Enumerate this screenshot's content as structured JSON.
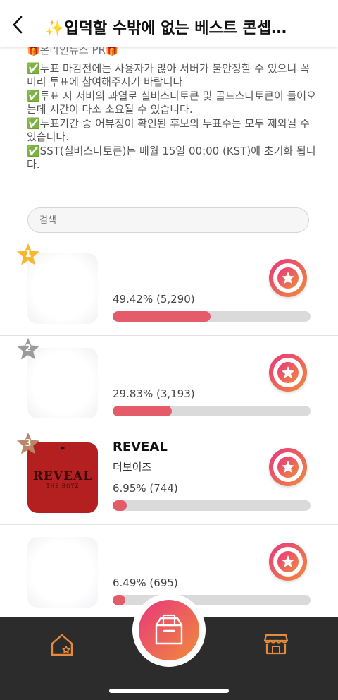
{
  "header": {
    "back_icon": "chevron-left-icon",
    "title": "✨입덕할 수밖에 없는 베스트 콘셉…"
  },
  "notice": {
    "gift_line": "🎁온라인뉴스 PR🎁",
    "lines": [
      "✅투표 마감전에는 사용자가 많아 서버가 불안정할 수 있으니 꼭 미리 투표에 참여해주시기 바랍니다",
      "✅투표 시 서버의 과열로 실버스타토큰 및 골드스타토큰이 들어오는데 시간이 다소 소요될 수 있습니다.",
      "✅투표기간 중 어뷰징이 확인된 후보의 투표수는 모두 제외될 수 있습니다.",
      "✅SST(실버스타토큰)는 매월 15일 00:00 (KST)에 초기화 됩니다."
    ]
  },
  "search": {
    "placeholder": "검색"
  },
  "candidates": [
    {
      "rank": "1",
      "rank_color": "#f5b82e",
      "title": "",
      "subtitle": "",
      "percent_text": "49.42% (5,290)",
      "percent": 49.42
    },
    {
      "rank": "2",
      "rank_color": "#9b9b9b",
      "title": "",
      "subtitle": "",
      "percent_text": "29.83% (3,193)",
      "percent": 29.83
    },
    {
      "rank": "3",
      "rank_color": "#b88767",
      "title": "REVEAL",
      "subtitle": "더보이즈",
      "percent_text": "6.95% (744)",
      "percent": 6.95
    },
    {
      "rank": "",
      "rank_color": "",
      "title": "",
      "subtitle": "",
      "percent_text": "6.49% (695)",
      "percent": 6.49
    }
  ],
  "album_art": {
    "logo_text": "REVEAL",
    "logo_sub": "THE BOYZ"
  },
  "bottom_nav": {
    "home_icon": "home-star-icon",
    "vote_icon": "ballot-box-icon",
    "shop_icon": "store-icon"
  },
  "colors": {
    "accent_start": "#e8377d",
    "accent_end": "#f08c3a",
    "bar_fill": "#e45b6a",
    "bar_track": "#dadada",
    "bottom_bar": "#2c2c2c",
    "nav_icon": "#e88a3c"
  }
}
